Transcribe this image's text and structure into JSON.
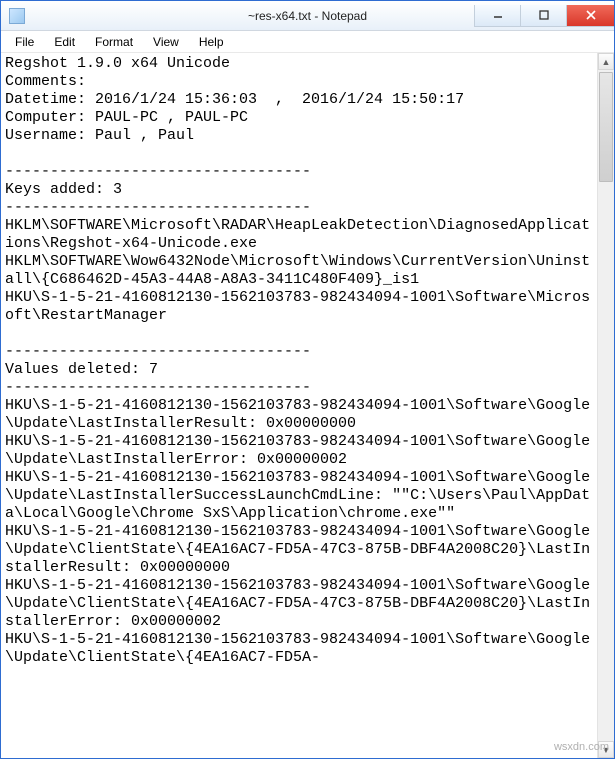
{
  "titlebar": {
    "title": "~res-x64.txt - Notepad"
  },
  "menubar": {
    "items": [
      "File",
      "Edit",
      "Format",
      "View",
      "Help"
    ]
  },
  "document": {
    "lines": [
      "Regshot 1.9.0 x64 Unicode",
      "Comments:",
      "Datetime: 2016/1/24 15:36:03  ,  2016/1/24 15:50:17",
      "Computer: PAUL-PC , PAUL-PC",
      "Username: Paul , Paul",
      "",
      "----------------------------------",
      "Keys added: 3",
      "----------------------------------",
      "HKLM\\SOFTWARE\\Microsoft\\RADAR\\HeapLeakDetection\\DiagnosedApplications\\Regshot-x64-Unicode.exe",
      "HKLM\\SOFTWARE\\Wow6432Node\\Microsoft\\Windows\\CurrentVersion\\Uninstall\\{C686462D-45A3-44A8-A8A3-3411C480F409}_is1",
      "HKU\\S-1-5-21-4160812130-1562103783-982434094-1001\\Software\\Microsoft\\RestartManager",
      "",
      "----------------------------------",
      "Values deleted: 7",
      "----------------------------------",
      "HKU\\S-1-5-21-4160812130-1562103783-982434094-1001\\Software\\Google\\Update\\LastInstallerResult: 0x00000000",
      "HKU\\S-1-5-21-4160812130-1562103783-982434094-1001\\Software\\Google\\Update\\LastInstallerError: 0x00000002",
      "HKU\\S-1-5-21-4160812130-1562103783-982434094-1001\\Software\\Google\\Update\\LastInstallerSuccessLaunchCmdLine: \"\"C:\\Users\\Paul\\AppData\\Local\\Google\\Chrome SxS\\Application\\chrome.exe\"\"",
      "HKU\\S-1-5-21-4160812130-1562103783-982434094-1001\\Software\\Google\\Update\\ClientState\\{4EA16AC7-FD5A-47C3-875B-DBF4A2008C20}\\LastInstallerResult: 0x00000000",
      "HKU\\S-1-5-21-4160812130-1562103783-982434094-1001\\Software\\Google\\Update\\ClientState\\{4EA16AC7-FD5A-47C3-875B-DBF4A2008C20}\\LastInstallerError: 0x00000002",
      "HKU\\S-1-5-21-4160812130-1562103783-982434094-1001\\Software\\Google\\Update\\ClientState\\{4EA16AC7-FD5A-"
    ]
  },
  "watermark": "wsxdn.com"
}
